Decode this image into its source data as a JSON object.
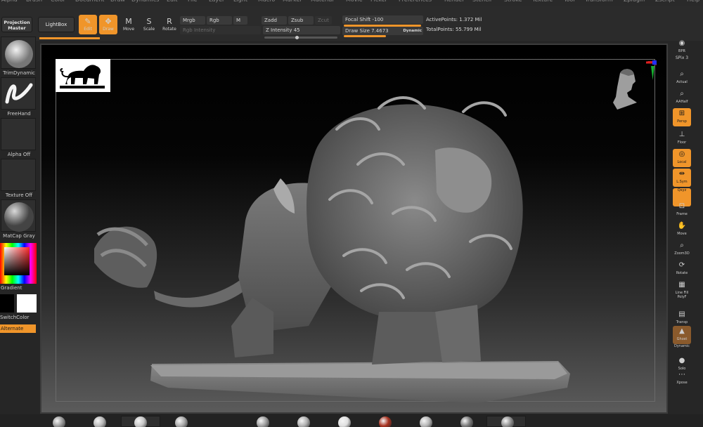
{
  "menu": [
    "Alpha",
    "Brush",
    "Color",
    "Document",
    "Draw",
    "Dynamics",
    "Edit",
    "File",
    "Layer",
    "Light",
    "Macro",
    "Marker",
    "Material",
    "Movie",
    "Picker",
    "Preferences",
    "Render",
    "Stencil",
    "Stroke",
    "Texture",
    "Tool",
    "Transform",
    "Zplugin",
    "Zscript",
    "Help"
  ],
  "toolbar": {
    "projection_master": "Projection Master",
    "lightbox": "LightBox",
    "tools": [
      {
        "label": "Edit",
        "icon": "edit-icon",
        "glyph": "✎",
        "active": true
      },
      {
        "label": "Draw",
        "icon": "draw-icon",
        "glyph": "✥",
        "active": true
      },
      {
        "label": "Move",
        "icon": "move-icon",
        "glyph": "M",
        "active": false
      },
      {
        "label": "Scale",
        "icon": "scale-icon",
        "glyph": "S",
        "active": false
      },
      {
        "label": "Rotate",
        "icon": "rotate-icon",
        "glyph": "R",
        "active": false
      }
    ],
    "mrgb": "Mrgb",
    "rgb": "Rgb",
    "m": "M",
    "rgb_intensity": "Rgb Intensity",
    "zadd": "Zadd",
    "zsub": "Zsub",
    "zcut": "Zcut",
    "z_intensity": "Z Intensity 45",
    "focal_shift": "Focal Shift -100",
    "draw_size": "Draw Size 7.4673",
    "dynamic": "Dynamic",
    "active_points": "ActivePoints: 1.372 Mil",
    "total_points": "TotalPoints: 55.799 Mil"
  },
  "left": {
    "brush": "TrimDynamic",
    "stroke": "FreeHand",
    "alpha": "Alpha Off",
    "texture": "Texture Off",
    "material": "MatCap Gray",
    "gradient": "Gradient",
    "switch_color": "SwitchColor",
    "alternate": "Alternate"
  },
  "right": [
    {
      "label": "BPR",
      "icon": "bpr-icon",
      "glyph": "◉",
      "state": "off"
    },
    {
      "label": "SPix 3",
      "icon": "spix-icon",
      "glyph": "",
      "state": "text"
    },
    {
      "label": "Actual",
      "icon": "actual-icon",
      "glyph": "⌕",
      "state": "off"
    },
    {
      "label": "AAHalf",
      "icon": "aahalf-icon",
      "glyph": "⌕",
      "state": "off"
    },
    {
      "label": "Persp",
      "icon": "persp-icon",
      "glyph": "⊞",
      "state": "on"
    },
    {
      "label": "Floor",
      "icon": "floor-icon",
      "glyph": "⊥",
      "state": "off"
    },
    {
      "label": "Local",
      "icon": "local-icon",
      "glyph": "◎",
      "state": "on"
    },
    {
      "label": "L.Sym",
      "icon": "lsym-icon",
      "glyph": "⇹",
      "state": "on"
    },
    {
      "label": "Qxyz",
      "icon": "xyz-icon",
      "glyph": "",
      "state": "on"
    },
    {
      "label": "Frame",
      "icon": "frame-icon",
      "glyph": "⊡",
      "state": "off"
    },
    {
      "label": "Move",
      "icon": "move-icon",
      "glyph": "✋",
      "state": "off"
    },
    {
      "label": "Zoom3D",
      "icon": "zoom3d-icon",
      "glyph": "⌕",
      "state": "off"
    },
    {
      "label": "Rotate",
      "icon": "rotate-icon",
      "glyph": "⟳",
      "state": "off"
    },
    {
      "label": "Line Fill",
      "icon": "linefill-icon",
      "glyph": "▦",
      "state": "off"
    },
    {
      "label": "PolyF",
      "icon": "polyf-icon",
      "glyph": "",
      "state": "off"
    },
    {
      "label": "Transp",
      "icon": "transp-icon",
      "glyph": "▤",
      "state": "off"
    },
    {
      "label": "Ghost",
      "icon": "ghost-icon",
      "glyph": "▲",
      "state": "brown"
    },
    {
      "label": "Dynamic",
      "icon": "dynamic-icon",
      "glyph": "",
      "state": "off"
    },
    {
      "label": "Solo",
      "icon": "solo-icon",
      "glyph": "●",
      "state": "off"
    },
    {
      "label": "Xpose",
      "icon": "xpose-icon",
      "glyph": "⋯",
      "state": "off"
    }
  ],
  "colors": {
    "accent": "#f0952a",
    "panel": "#2b2b2b",
    "viewport_bg": "#000000"
  },
  "shelf_balls": [
    "#9a9a9a",
    "#b8b8b8",
    "#c6c6c6",
    "#a8a8a8",
    "#9e9e9e",
    "#b0b0b0",
    "#e0e0e0",
    "#a83220",
    "#b5b5b5",
    "#7a7a7a",
    "#8f8f8f"
  ]
}
